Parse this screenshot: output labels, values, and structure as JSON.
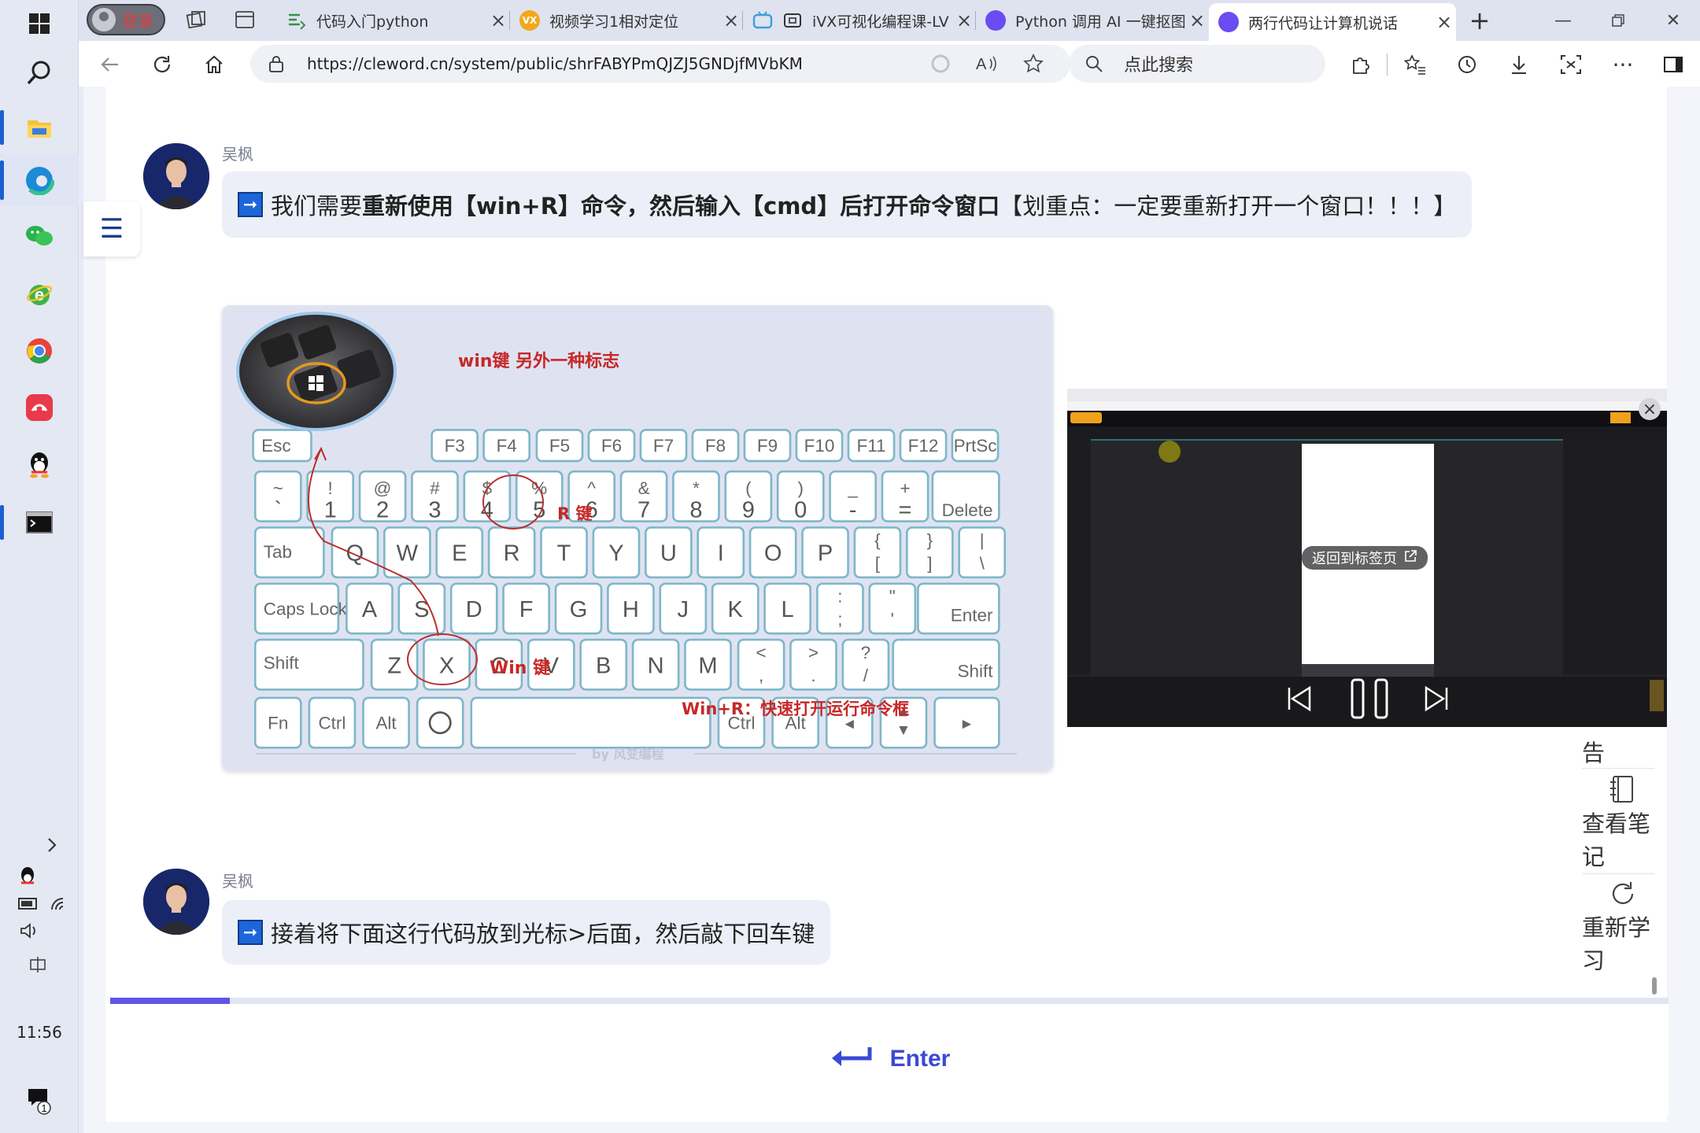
{
  "taskbar": {
    "icons": [
      "windows-start-icon",
      "search-icon",
      "file-explorer-icon",
      "edge-icon",
      "wechat-icon",
      "ie-browser-icon",
      "chrome-icon",
      "music-app-icon",
      "qq-icon",
      "terminal-icon"
    ],
    "tray": [
      "chevron-right-icon",
      "qq-tray-icon",
      "battery-icon",
      "wifi-icon",
      "volume-icon",
      "ime-icon"
    ],
    "clock": "11:56",
    "notification_count": "1"
  },
  "browser": {
    "login_label": "登录",
    "tabs": [
      {
        "title": "代码入门python",
        "favicon_color": "#3a8f4a"
      },
      {
        "title": "视频学习1相对定位",
        "favicon_color": "#f2a81c",
        "favicon_text": "VX"
      },
      {
        "title": "iVX可视化编程课-LV",
        "favicon_color": "#3aa0d8"
      },
      {
        "title": "Python 调用 AI 一键抠图",
        "favicon_color": "#6a4cf2"
      },
      {
        "title": "两行代码让计算机说话",
        "favicon_color": "#6a4cf2",
        "active": true
      }
    ],
    "new_tab": "+",
    "url": "https://cleword.cn/system/public/shrFABYPmQJZJ5GNDjfMVbKM",
    "search_placeholder": "点此搜索"
  },
  "chat": {
    "messages": [
      {
        "sender": "吴枫",
        "text_before": "我们需要",
        "text_bold": "重新使用【win+R】命令，然后输入【cmd】后打开命令窗口",
        "text_after": "【划重点：一定要重新打开一个窗口！！！】"
      },
      {
        "sender": "吴枫",
        "text": "接着将下面这行代码放到光标>后面，然后敲下回车键"
      }
    ],
    "image": {
      "win_label": "win键 另外一种标志",
      "r_label": "R 键",
      "win_key_label": "Win 键",
      "caption": "Win+R：快速打开运行命令框",
      "watermark": "by 风变编程",
      "keyboard": {
        "fn_row": [
          "Esc",
          "F3",
          "F4",
          "F5",
          "F6",
          "F7",
          "F8",
          "F9",
          "F10",
          "F11",
          "F12",
          "PrtSc"
        ],
        "num_row_top": [
          "~",
          "!",
          "@",
          "#",
          "$",
          "%",
          "^",
          "&",
          "*",
          "(",
          ")",
          "_",
          "+"
        ],
        "num_row_bottom": [
          "`",
          "1",
          "2",
          "3",
          "4",
          "5",
          "6",
          "7",
          "8",
          "9",
          "0",
          "-",
          "="
        ],
        "delete": "Delete",
        "tab": "Tab",
        "qwerty": [
          "Q",
          "W",
          "E",
          "R",
          "T",
          "Y",
          "U",
          "I",
          "O",
          "P"
        ],
        "brackets_top": [
          "{",
          "}",
          "|"
        ],
        "brackets_bottom": [
          "[",
          "]",
          "\\"
        ],
        "caps": "Caps Lock",
        "asdf": [
          "A",
          "S",
          "D",
          "F",
          "G",
          "H",
          "J",
          "K",
          "L"
        ],
        "semi_top": [
          ":",
          "\""
        ],
        "semi_bottom": [
          ";",
          "'"
        ],
        "enter": "Enter",
        "shift": "Shift",
        "zxcv": [
          "Z",
          "X",
          "C",
          "V",
          "B",
          "N",
          "M"
        ],
        "punct_top": [
          "<",
          ">",
          "?"
        ],
        "punct_bottom": [
          ",",
          ".",
          "/"
        ],
        "bottom_row": [
          "Fn",
          "Ctrl",
          "Alt",
          "Ctrl",
          "Alt"
        ]
      }
    }
  },
  "video": {
    "return_label": "返回到标签页",
    "close": "×"
  },
  "side_panel": {
    "partial_label": "告",
    "notes_label": "查看笔记",
    "relearn_label": "重新学习"
  },
  "progress": {
    "fraction": 0.077
  },
  "enter_button": {
    "label": "Enter"
  }
}
